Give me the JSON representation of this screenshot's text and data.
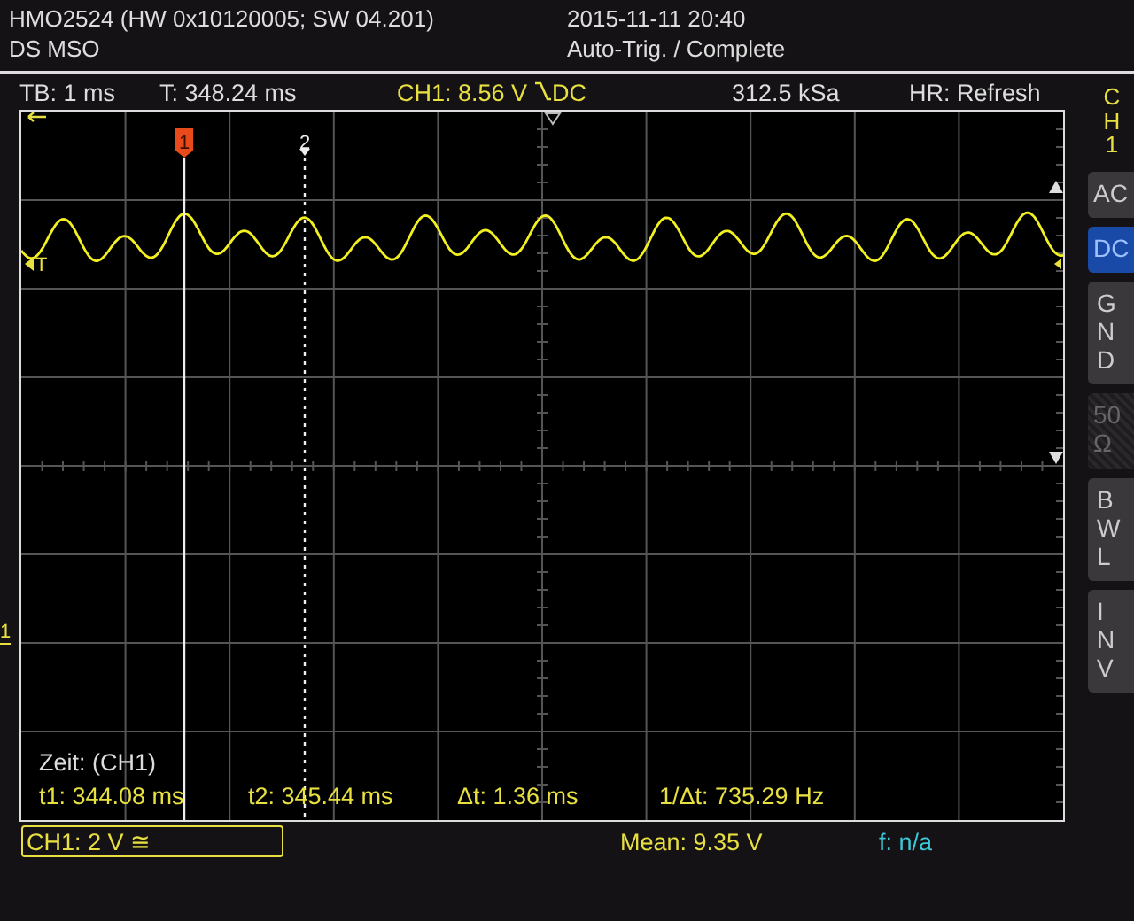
{
  "header": {
    "device": "HMO2524 (HW 0x10120005; SW 04.201)",
    "mode": "DS MSO",
    "datetime": "2015-11-11 20:40",
    "status": "Auto-Trig. / Complete"
  },
  "info_bar": {
    "timebase": "TB: 1 ms",
    "trigger_time": "T: 348.24 ms",
    "trigger_level": "CH1: 8.56 V",
    "trigger_coupling": "DC",
    "sample_rate": "312.5 kSa",
    "acquisition": "HR: Refresh"
  },
  "cursors": [
    {
      "label": "1",
      "selected": true
    },
    {
      "label": "2",
      "selected": false
    }
  ],
  "markers": {
    "trigger": "T",
    "channel": "1"
  },
  "measurement": {
    "title": "Zeit: (CH1)",
    "values": [
      "t1: 344.08 ms",
      "t2: 345.44 ms",
      "Δt: 1.36 ms",
      "1/Δt: 735.29 Hz"
    ]
  },
  "side_menu": {
    "title": "CH1",
    "buttons": [
      {
        "label": "AC",
        "kind": "horizontal",
        "selected": false,
        "disabled": false
      },
      {
        "label": "DC",
        "kind": "horizontal",
        "selected": true,
        "disabled": false
      },
      {
        "label": "GND",
        "kind": "vertical",
        "selected": false,
        "disabled": false
      },
      {
        "label": "50Ω",
        "kind": "wrapped",
        "selected": false,
        "disabled": true
      },
      {
        "label": "BWL",
        "kind": "vertical",
        "selected": false,
        "disabled": false
      },
      {
        "label": "INV",
        "kind": "vertical",
        "selected": false,
        "disabled": false
      }
    ]
  },
  "status_bar": {
    "channel_scale": "CH1: 2 V ≅",
    "mean": "Mean: 9.35 V",
    "frequency": "f: n/a"
  }
}
